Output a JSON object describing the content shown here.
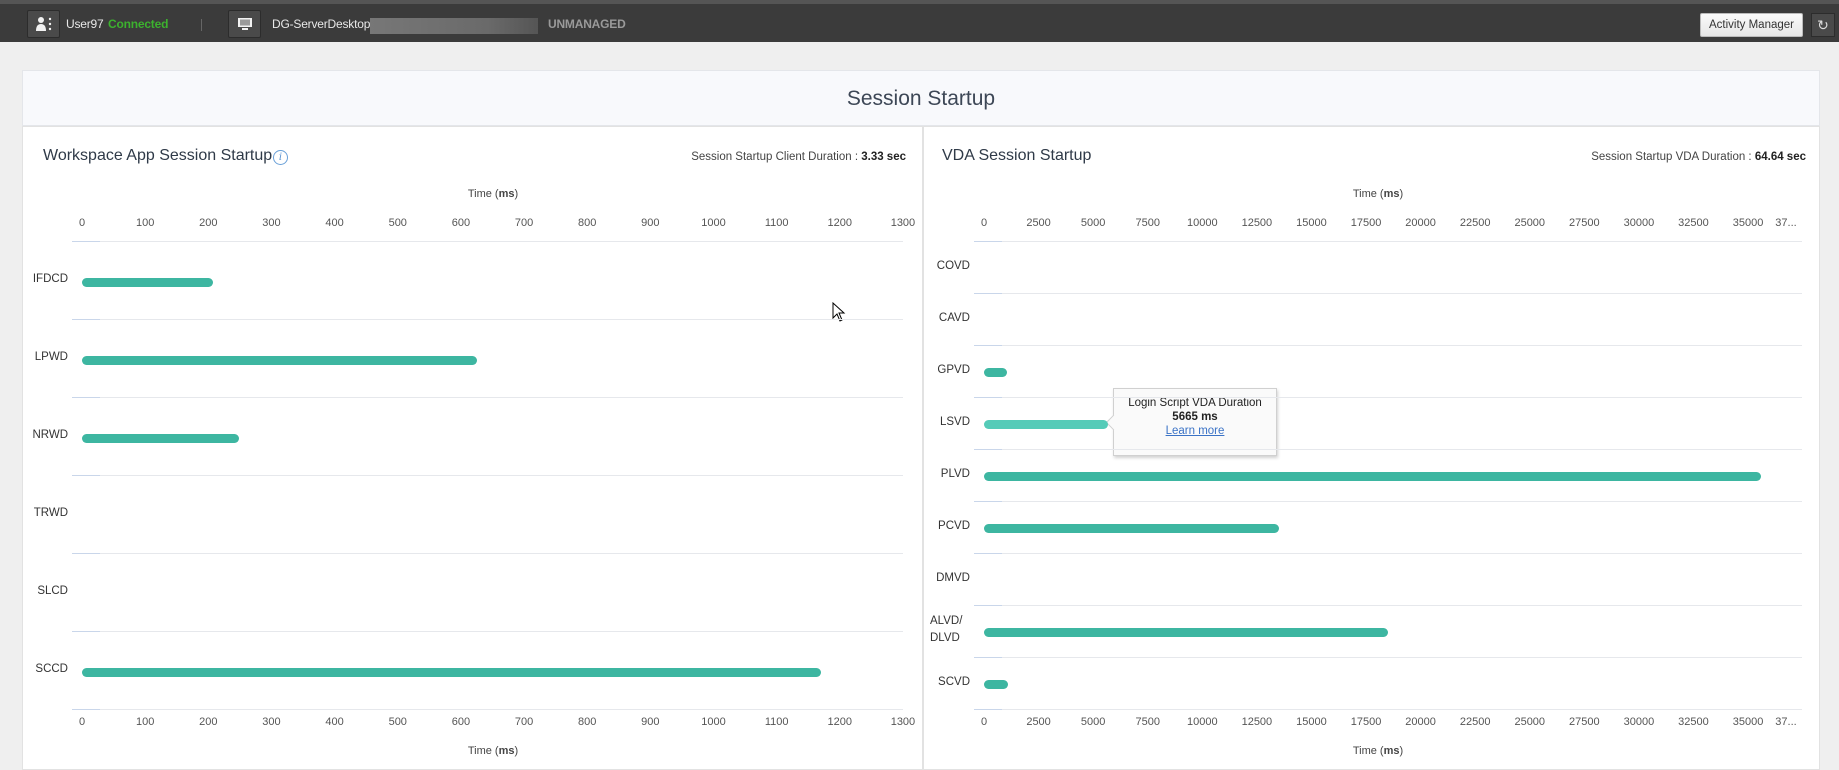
{
  "topbar": {
    "user_name": "User97",
    "user_status": "Connected",
    "machine_name": "DG-ServerDesktop",
    "machine_state": "UNMANAGED",
    "activity_manager_label": "Activity Manager",
    "refresh_icon": "↻",
    "colors": {
      "connected": "#3cb12e",
      "unmanaged": "#9a9a9a"
    }
  },
  "page_title": "Session Startup",
  "left_panel": {
    "title": "Workspace App Session Startup",
    "meta_label": "Session Startup Client Duration : ",
    "meta_value": "3.33 sec",
    "info_icon": "i",
    "axis_title_prefix": "Time (",
    "axis_title_unit": "ms",
    "axis_title_suffix": ")"
  },
  "right_panel": {
    "title": "VDA Session Startup",
    "meta_label": "Session Startup VDA Duration : ",
    "meta_value": "64.64 sec",
    "axis_title_prefix": "Time (",
    "axis_title_unit": "ms",
    "axis_title_suffix": ")"
  },
  "tooltip": {
    "title": "Login Script VDA Duration",
    "value": "5665 ms",
    "link": "Learn more"
  },
  "chart_data": [
    {
      "type": "bar",
      "orientation": "horizontal",
      "title": "Workspace App Session Startup",
      "xlabel": "Time (ms)",
      "xlim": [
        0,
        1300
      ],
      "ticks": [
        "0",
        "100",
        "200",
        "300",
        "400",
        "500",
        "600",
        "700",
        "800",
        "900",
        "1000",
        "1100",
        "1200",
        "1300"
      ],
      "tick_values": [
        0,
        100,
        200,
        300,
        400,
        500,
        600,
        700,
        800,
        900,
        1000,
        1100,
        1200,
        1300
      ],
      "categories": [
        "IFDCD",
        "LPWD",
        "NRWD",
        "TRWD",
        "SLCD",
        "SCCD"
      ],
      "values": [
        208,
        625,
        248,
        0,
        0,
        1170
      ],
      "color": "#3db6a1"
    },
    {
      "type": "bar",
      "orientation": "horizontal",
      "title": "VDA Session Startup",
      "xlabel": "Time (ms)",
      "xlim": [
        0,
        37500
      ],
      "ticks": [
        "0",
        "2500",
        "5000",
        "7500",
        "10000",
        "12500",
        "15000",
        "17500",
        "20000",
        "22500",
        "25000",
        "27500",
        "30000",
        "32500",
        "35000",
        "37..."
      ],
      "tick_values": [
        0,
        2500,
        5000,
        7500,
        10000,
        12500,
        15000,
        17500,
        20000,
        22500,
        25000,
        27500,
        30000,
        32500,
        35000,
        37500
      ],
      "categories": [
        "COVD",
        "CAVD",
        "GPVD",
        "LSVD",
        "PLVD",
        "PCVD",
        "DMVD",
        "ALVD/\nDLVD",
        "SCVD"
      ],
      "category_lines": [
        [
          "COVD"
        ],
        [
          "CAVD"
        ],
        [
          "GPVD"
        ],
        [
          "LSVD"
        ],
        [
          "PLVD"
        ],
        [
          "PCVD"
        ],
        [
          "DMVD"
        ],
        [
          "ALVD/",
          "DLVD"
        ],
        [
          "SCVD"
        ]
      ],
      "values": [
        0,
        0,
        1050,
        5665,
        35600,
        13500,
        0,
        18500,
        1100
      ],
      "highlighted": "LSVD",
      "color": "#3db6a1",
      "highlight_color": "#55cbb8"
    }
  ]
}
